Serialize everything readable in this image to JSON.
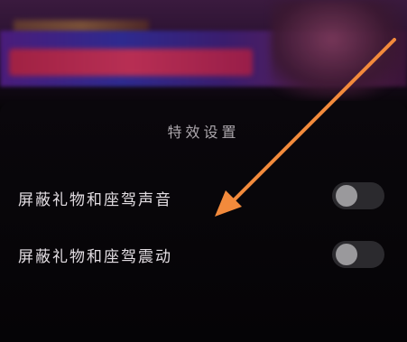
{
  "background": {
    "description_colors": {
      "banner_purple": "#4a1c7a",
      "banner_red": "#d0304a",
      "panel": "#070508"
    }
  },
  "settings_panel": {
    "title": "特效设置",
    "rows": [
      {
        "label": "屏蔽礼物和座驾声音",
        "toggle_on": false
      },
      {
        "label": "屏蔽礼物和座驾震动",
        "toggle_on": false
      }
    ]
  },
  "annotation": {
    "arrow_color": "#f28a3c",
    "points_to": "屏蔽礼物和座驾声音"
  }
}
